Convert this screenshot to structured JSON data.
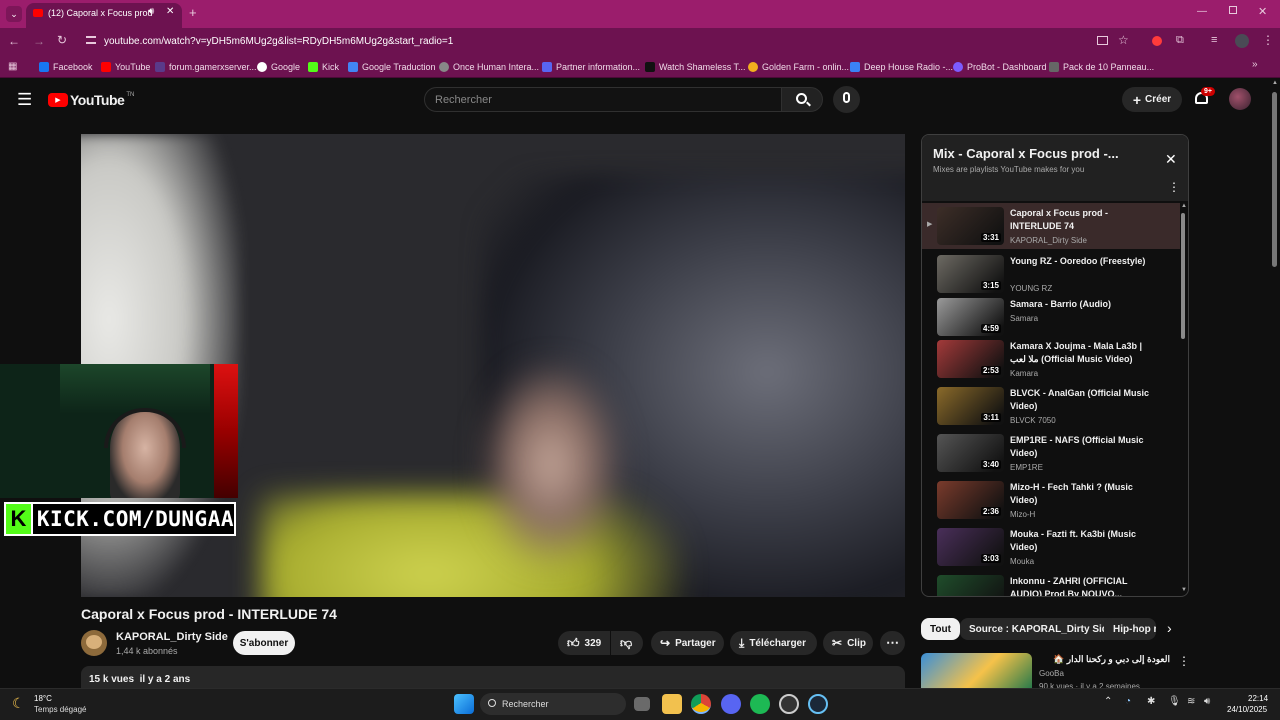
{
  "browser": {
    "tab_title": "(12) Caporal x Focus prod",
    "url": "youtube.com/watch?v=yDH5m6MUg2g&list=RDyDH5m6MUg2g&start_radio=1",
    "bookmarks": [
      {
        "label": "Facebook",
        "color": "#1877f2"
      },
      {
        "label": "YouTube",
        "color": "#ff0000"
      },
      {
        "label": "forum.gamerxserver...",
        "color": "#5a3a8a"
      },
      {
        "label": "Google",
        "color": "#ffffff"
      },
      {
        "label": "Kick",
        "color": "#53fc18"
      },
      {
        "label": "Google Traduction",
        "color": "#4285f4"
      },
      {
        "label": "Once Human Intera...",
        "color": "#888888"
      },
      {
        "label": "Partner information...",
        "color": "#5865f2"
      },
      {
        "label": "Watch Shameless T...",
        "color": "#111111"
      },
      {
        "label": "Golden Farm - onlin...",
        "color": "#f2b01e"
      },
      {
        "label": "Deep House Radio -...",
        "color": "#3b82f6"
      },
      {
        "label": "ProBot - Dashboard",
        "color": "#7c5cff"
      },
      {
        "label": "Pack de 10 Panneau...",
        "color": "#666666"
      }
    ]
  },
  "youtube": {
    "logo": "YouTube",
    "logo_suffix": "TN",
    "search_placeholder": "Rechercher",
    "create_label": "Créer",
    "notif_badge": "9+"
  },
  "video": {
    "title": "Caporal x Focus prod - INTERLUDE 74",
    "channel": "KAPORAL_Dirty Side",
    "subscribers": "1,44 k abonnés",
    "subscribe_label": "S'abonner",
    "likes": "329",
    "share_label": "Partager",
    "download_label": "Télécharger",
    "clip_label": "Clip",
    "views_date": "15 k vues  il y a 2 ans",
    "overlay_kick": "KICK.COM/DUNGAA"
  },
  "playlist": {
    "title": "Mix - Caporal x Focus prod -...",
    "subtitle": "Mixes are playlists YouTube makes for you",
    "items": [
      {
        "title": "Caporal x Focus prod - INTERLUDE 74",
        "channel": "KAPORAL_Dirty Side",
        "duration": "3:31",
        "color": "#3d2e28"
      },
      {
        "title": "Young RZ - Ooredoo (Freestyle)",
        "channel": "YOUNG RZ",
        "duration": "3:15",
        "color": "#6d6a63"
      },
      {
        "title": "Samara - Barrio (Audio)",
        "channel": "Samara",
        "duration": "4:59",
        "color": "#9a9a9a"
      },
      {
        "title": "Kamara X Joujma - Mala La3b | ملا لعب (Official Music Video)",
        "channel": "Kamara",
        "duration": "2:53",
        "color": "#a33a3a"
      },
      {
        "title": "BLVCK - AnalGan (Official Music Video)",
        "channel": "BLVCK 7050",
        "duration": "3:11",
        "color": "#8a6a2a"
      },
      {
        "title": "EMP1RE - NAFS (Official Music Video)",
        "channel": "EMP1RE",
        "duration": "3:40",
        "color": "#555555"
      },
      {
        "title": "Mizo-H - Fech Tahki ? (Music Video)",
        "channel": "Mizo-H",
        "duration": "2:36",
        "color": "#7a3b2c"
      },
      {
        "title": "Mouka - Fazti ft. Ka3bi (Music Video)",
        "channel": "Mouka",
        "duration": "3:03",
        "color": "#4a2f5a"
      },
      {
        "title": "Inkonnu - ZAHRI (OFFICIAL AUDIO) Prod.By NOUVO...",
        "channel": "",
        "duration": "",
        "color": "#1f4d2b"
      }
    ]
  },
  "chips": [
    "Tout",
    "Source : KAPORAL_Dirty Side",
    "Hip-hop r"
  ],
  "reco": {
    "title": "العودة إلى دبي و ركحنا الدار 🏠",
    "channel": "GooBa",
    "meta": "90 k vues · il y a 2 semaines"
  },
  "taskbar": {
    "weather_temp": "18°C",
    "weather_desc": "Temps dégagé",
    "search_label": "Rechercher",
    "time": "22:14",
    "date": "24/10/2025"
  }
}
